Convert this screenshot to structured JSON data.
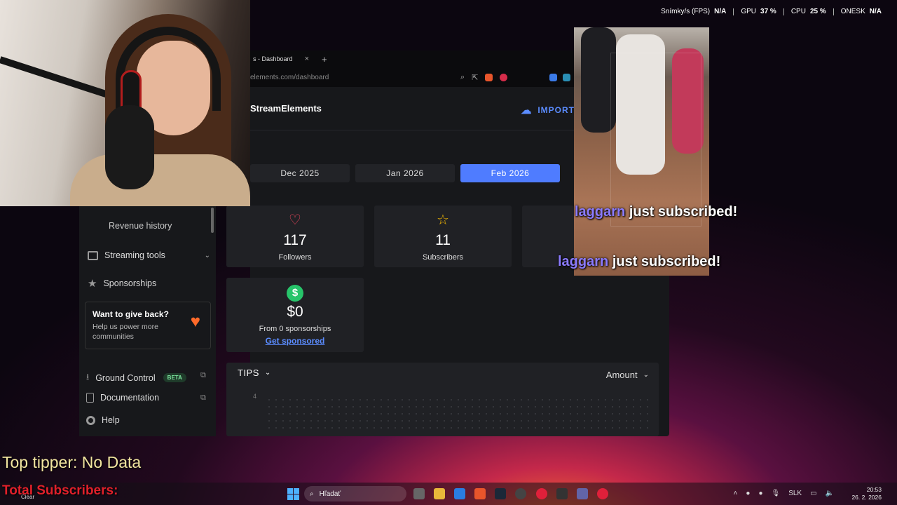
{
  "osd": {
    "fps_label": "Snímky/s (FPS)",
    "fps_value": "N/A",
    "gpu_label": "GPU",
    "gpu_value": "37 %",
    "cpu_label": "CPU",
    "cpu_value": "25 %",
    "onesk_label": "ONESK",
    "onesk_value": "N/A"
  },
  "browser": {
    "tab_title": "s - Dashboard",
    "tab_close": "×",
    "new_tab": "+",
    "url": "elements.com/dashboard"
  },
  "app": {
    "logo": "StreamElements",
    "import_label": "IMPORT",
    "months": [
      "Dec 2025",
      "Jan 2026",
      "Feb 2026"
    ],
    "active_month": "Feb 2026"
  },
  "sidebar": {
    "revenue_history": "Revenue history",
    "streaming_tools": "Streaming tools",
    "sponsorships": "Sponsorships",
    "giveback_title": "Want to give back?",
    "giveback_text": "Help us power more communities",
    "ground_control": "Ground Control",
    "beta": "BETA",
    "documentation": "Documentation",
    "help": "Help"
  },
  "stats": {
    "followers_value": "117",
    "followers_label": "Followers",
    "subscribers_value": "11",
    "subscribers_label": "Subscribers",
    "sponsorship_value": "$0",
    "sponsorship_label": "From 0 sponsorships",
    "sponsorship_link": "Get sponsored"
  },
  "tips": {
    "title": "TIPS",
    "sort": "Amount",
    "axis_value": "4"
  },
  "alerts": {
    "name": "laggarn",
    "text": "just subscribed!"
  },
  "overlay": {
    "top_tipper": "Top tipper: No Data",
    "total_subs": "Total Subscribers:"
  },
  "taskbar": {
    "weather": "Clear",
    "search": "Hľadať",
    "lang": "SLK",
    "time": "20:53",
    "date": "26. 2. 2026"
  },
  "colors": {
    "accent": "#4f7cff",
    "link": "#5b8cff",
    "alert_name": "#8b7bff",
    "total_subs": "#e0202a"
  }
}
